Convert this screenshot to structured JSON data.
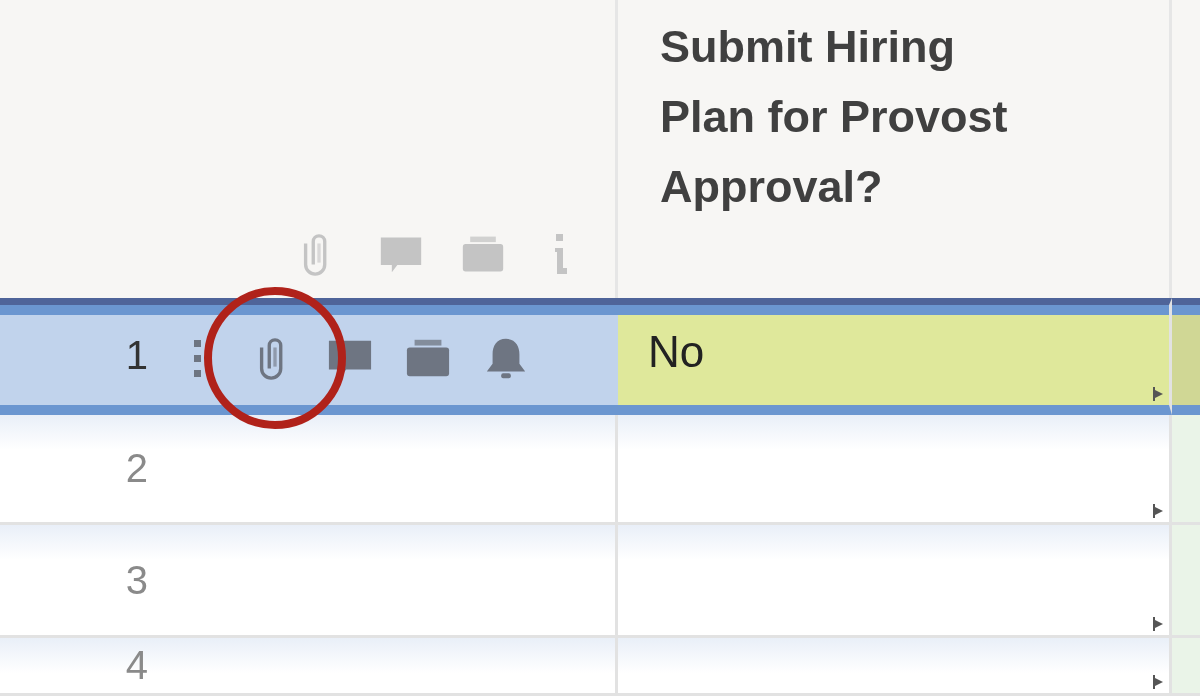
{
  "header": {
    "icons": [
      {
        "kind": "attachment"
      },
      {
        "kind": "comment"
      },
      {
        "kind": "proof"
      },
      {
        "kind": "info"
      }
    ],
    "column_title": "Submit Hiring Plan for Provost Approval?"
  },
  "rows": [
    {
      "number": "1",
      "selected": true,
      "circled": true,
      "value": "No",
      "icons": [
        {
          "kind": "handle"
        },
        {
          "kind": "attachment"
        },
        {
          "kind": "comment"
        },
        {
          "kind": "proof"
        },
        {
          "kind": "bell"
        }
      ]
    },
    {
      "number": "2",
      "selected": false,
      "circled": false
    },
    {
      "number": "3",
      "selected": false,
      "circled": false
    },
    {
      "number": "4",
      "selected": false,
      "circled": false
    }
  ]
}
